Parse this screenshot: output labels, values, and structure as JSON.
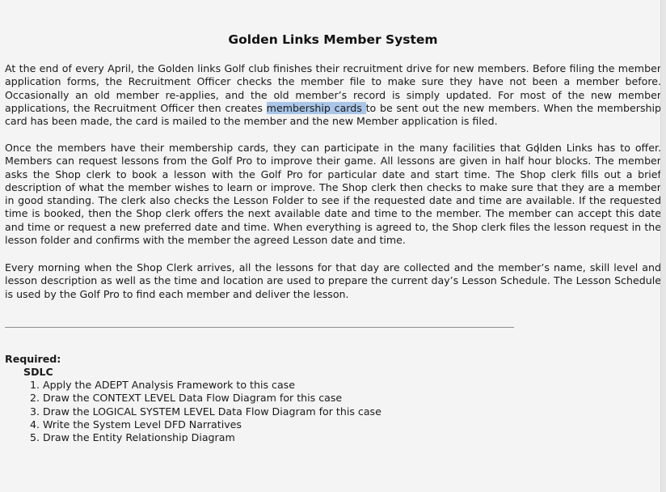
{
  "document": {
    "title": "Golden Links Member System",
    "paragraph1": {
      "before": "At the end of every April, the Golden links Golf club finishes their recruitment drive for new members. Before filing the member application forms, the Recruitment Officer checks the member file to make sure they have not been a member before. Occasionally an old member re-applies, and the old member’s record is simply updated. For most of the new member applications, the Recruitment Officer then creates ",
      "highlight": "membership cards ",
      "after": "to be sent out the new members. When the membership card has been made, the card is mailed to the member and the new Member application is filed."
    },
    "paragraph2": "Once the members have their membership cards, they can participate in the many facilities that Golden Links has to offer. Members can request lessons from the Golf Pro to improve their game. All lessons are given in half hour blocks. The member asks the Shop clerk to book a lesson with the Golf Pro for particular date and start time. The Shop clerk fills out a brief description of what the member wishes to learn or improve. The Shop clerk then checks to make sure that they are a member in good standing. The clerk also checks the Lesson Folder to see if the requested date and time are available. If the requested time is booked, then the Shop clerk offers the next available date and time to the member. The member can accept this date and time or request a new preferred date and time. When everything is agreed to, the Shop clerk files the lesson request in the lesson folder and confirms with the member the agreed Lesson date and time.",
    "paragraph3": "Every morning when the Shop Clerk arrives, all the lessons for that day are collected and the member’s name, skill level and lesson description as well as the time and location are used to prepare the current day’s Lesson Schedule. The Lesson Schedule is used by the Golf Pro to find each member and deliver the lesson.",
    "required_label": "Required:",
    "sdlc_label": "SDLC",
    "tasks": [
      "Apply the ADEPT Analysis Framework to this case",
      "Draw the CONTEXT LEVEL Data Flow Diagram for this case",
      "Draw the LOGICAL SYSTEM LEVEL Data Flow Diagram for this case",
      "Write the System Level DFD Narratives",
      "Draw the Entity Relationship Diagram"
    ]
  },
  "colors": {
    "background": "#f4f4f4",
    "text": "#1a1a1a",
    "selection_highlight": "#a9c6e8"
  }
}
